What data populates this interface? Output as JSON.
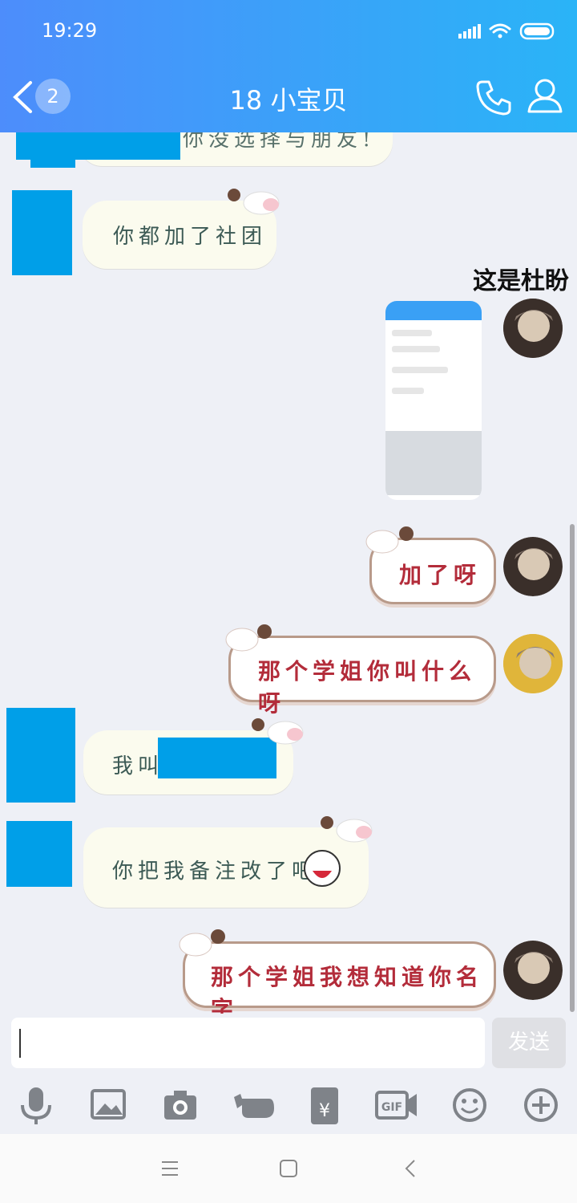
{
  "status_bar": {
    "time": "19:29"
  },
  "header": {
    "unread_count": "2",
    "title": "18  小宝贝"
  },
  "annotation": "这是杜盼",
  "messages": [
    {
      "side": "left",
      "text": "你没选择与朋友!"
    },
    {
      "side": "left",
      "text": "你都加了社团"
    },
    {
      "side": "right",
      "type": "image",
      "text": ""
    },
    {
      "side": "right",
      "text": "加了呀"
    },
    {
      "side": "right",
      "text": "那个学姐你叫什么呀"
    },
    {
      "side": "left",
      "text": "我叫"
    },
    {
      "side": "left",
      "text": "你把我备注改了吧"
    },
    {
      "side": "right",
      "text": "那个学姐我想知道你名字"
    }
  ],
  "composer": {
    "send_label": "发送",
    "placeholder": ""
  },
  "toolbar_icons": [
    "microphone-icon",
    "image-icon",
    "camera-icon",
    "hand-icon",
    "red-packet-icon",
    "gif-icon",
    "emoji-icon",
    "plus-icon"
  ],
  "colors": {
    "header_start": "#4d8dfb",
    "header_end": "#2ab4f7",
    "redaction": "#009fe8",
    "bubble_text": "#3c5a55",
    "self_text": "#b32c3a"
  }
}
